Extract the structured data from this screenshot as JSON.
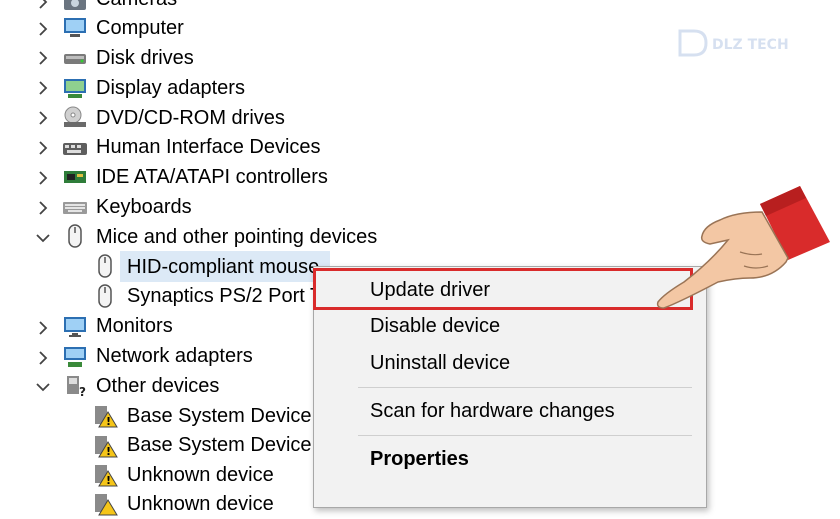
{
  "tree": {
    "items": [
      {
        "label": "Cameras",
        "icon": "camera-icon",
        "expanded": false,
        "level": 0
      },
      {
        "label": "Computer",
        "icon": "computer-icon",
        "expanded": false,
        "level": 0
      },
      {
        "label": "Disk drives",
        "icon": "disk-drive-icon",
        "expanded": false,
        "level": 0
      },
      {
        "label": "Display adapters",
        "icon": "display-adapter-icon",
        "expanded": false,
        "level": 0
      },
      {
        "label": "DVD/CD-ROM drives",
        "icon": "dvd-drive-icon",
        "expanded": false,
        "level": 0
      },
      {
        "label": "Human Interface Devices",
        "icon": "hid-icon",
        "expanded": false,
        "level": 0
      },
      {
        "label": "IDE ATA/ATAPI controllers",
        "icon": "ide-controller-icon",
        "expanded": false,
        "level": 0
      },
      {
        "label": "Keyboards",
        "icon": "keyboard-icon",
        "expanded": false,
        "level": 0
      },
      {
        "label": "Mice and other pointing devices",
        "icon": "mouse-icon",
        "expanded": true,
        "level": 0
      },
      {
        "label": "HID-compliant mouse",
        "icon": "mouse-icon",
        "level": 1,
        "selected": true
      },
      {
        "label": "Synaptics PS/2 Port T",
        "icon": "mouse-icon",
        "level": 1
      },
      {
        "label": "Monitors",
        "icon": "monitor-icon",
        "expanded": false,
        "level": 0
      },
      {
        "label": "Network adapters",
        "icon": "network-adapter-icon",
        "expanded": false,
        "level": 0
      },
      {
        "label": "Other devices",
        "icon": "other-devices-icon",
        "expanded": true,
        "level": 0
      },
      {
        "label": "Base System Device",
        "icon": "warning-device-icon",
        "level": 1
      },
      {
        "label": "Base System Device",
        "icon": "warning-device-icon",
        "level": 1
      },
      {
        "label": "Unknown device",
        "icon": "warning-device-icon",
        "level": 1
      },
      {
        "label": "Unknown device",
        "icon": "warning-device-icon",
        "level": 1
      }
    ]
  },
  "context_menu": {
    "update_driver": "Update driver",
    "disable_device": "Disable device",
    "uninstall_device": "Uninstall device",
    "scan_hardware": "Scan for hardware changes",
    "properties": "Properties"
  },
  "watermark": {
    "text": "DLZ TECH"
  },
  "colors": {
    "highlight": "#d92b2b",
    "selection": "#dce9f6",
    "menu_bg": "#f2f2f2"
  }
}
